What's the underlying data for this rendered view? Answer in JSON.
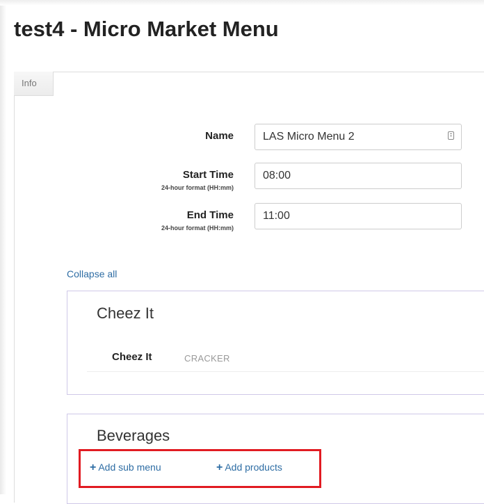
{
  "page": {
    "title": "test4 - Micro Market Menu"
  },
  "tabs": [
    {
      "label": "Info"
    }
  ],
  "form": {
    "name": {
      "label": "Name",
      "value": "LAS Micro Menu 2"
    },
    "start_time": {
      "label": "Start Time",
      "hint": "24-hour format (HH:mm)",
      "value": "08:00"
    },
    "end_time": {
      "label": "End Time",
      "hint": "24-hour format (HH:mm)",
      "value": "11:00"
    }
  },
  "collapse_label": "Collapse all",
  "menus": [
    {
      "title": "Cheez It",
      "products": [
        {
          "name": "Cheez It",
          "category": "CRACKER"
        }
      ]
    },
    {
      "title": "Beverages",
      "actions": {
        "add_sub_menu": "Add sub menu",
        "add_products": "Add products"
      }
    }
  ],
  "colors": {
    "link": "#2e6da4",
    "highlight": "#e11b22",
    "menu_border": "#cfc8e8"
  },
  "icons": {
    "plus": "plus-icon",
    "field_menu": "field-options-icon"
  }
}
